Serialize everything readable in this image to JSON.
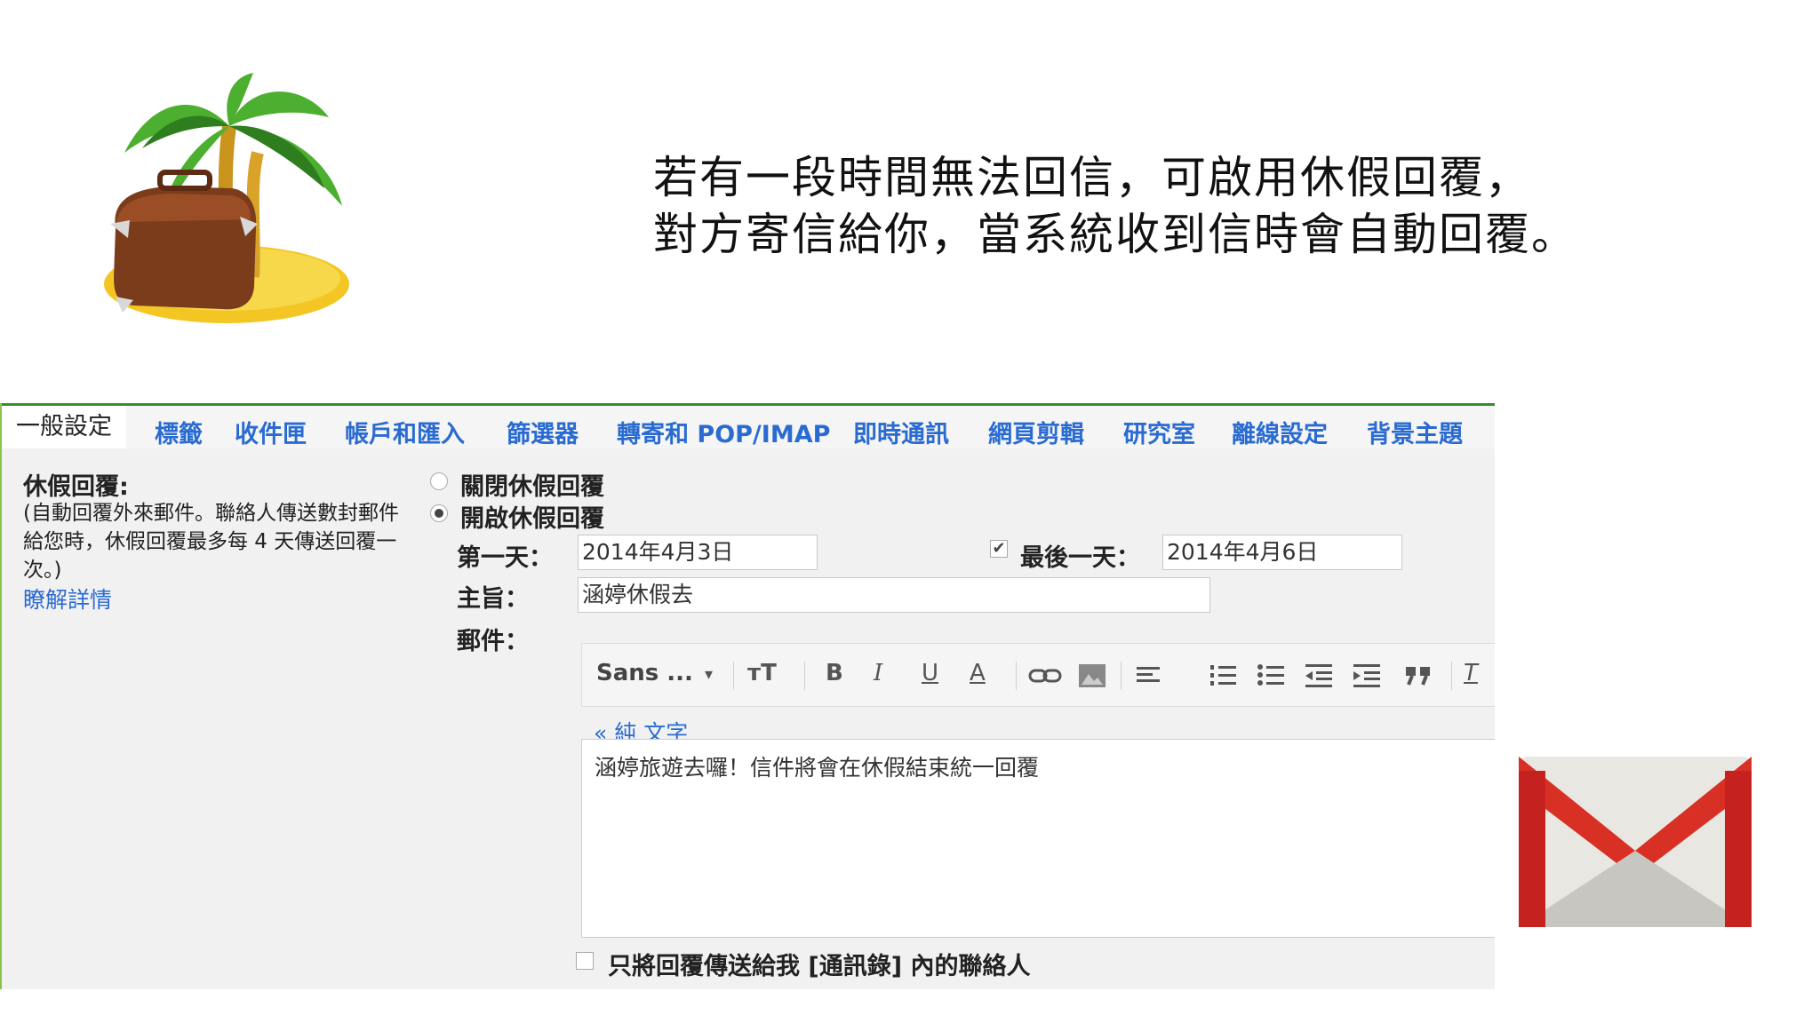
{
  "slide": {
    "line1": "若有一段時間無法回信，可啟用休假回覆，",
    "line2": "對方寄信給你，當系統收到信時會自動回覆。"
  },
  "tabs": [
    "一般設定",
    "標籤",
    "收件匣",
    "帳戶和匯入",
    "篩選器",
    "轉寄和 POP/IMAP",
    "即時通訊",
    "網頁剪輯",
    "研究室",
    "離線設定",
    "背景主題"
  ],
  "vacation": {
    "heading": "休假回覆:",
    "description": "(自動回覆外來郵件。聯絡人傳送數封郵件給您時，休假回覆最多每 4 天傳送回覆一次。)",
    "learn_more": "瞭解詳情",
    "off_label": "關閉休假回覆",
    "on_label": "開啟休假回覆",
    "on_selected": true
  },
  "form": {
    "first_day_label": "第一天：",
    "first_day_value": "2014年4月3日",
    "last_day_label": "最後一天：",
    "last_day_checked": true,
    "last_day_value": "2014年4月6日",
    "subject_label": "主旨：",
    "subject_value": "涵婷休假去",
    "message_label": "郵件：",
    "plain_text_link": "« 純 文字",
    "message_body": "涵婷旅遊去囉！信件將會在休假結束統一回覆",
    "contacts_only_label": "只將回覆傳送給我 [通訊錄] 內的聯絡人",
    "contacts_only_checked": false
  },
  "toolbar": {
    "font": "Sans ...",
    "font_dropdown_icon": "▾",
    "size_icon": "тT",
    "bold": "B",
    "italic": "I",
    "underline": "U",
    "text_color": "A",
    "remove_format": "T"
  },
  "colors": {
    "link": "#2a6bd1",
    "tab_border": "#3c8a2e",
    "panel_bg": "#f1f1f1",
    "gmail_red": "#d93025"
  }
}
